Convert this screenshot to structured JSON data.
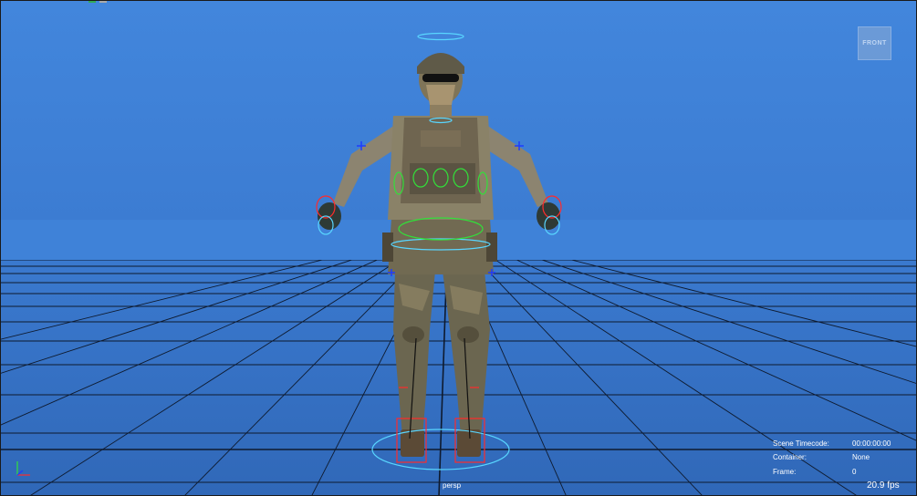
{
  "viewport": {
    "view_cube_label": "FRONT",
    "camera_name": "persp",
    "fps": "20.9 fps"
  },
  "hud": {
    "scene_timecode_label": "Scene Timecode:",
    "scene_timecode_value": "00:00:00:00",
    "container_label": "Container:",
    "container_value": "None",
    "frame_label": "Frame:",
    "frame_value": "0"
  },
  "colors": {
    "viewport_top": "#4286dc",
    "viewport_bottom": "#3068b8",
    "grid": "#0e1a2e",
    "control_cyan": "#59d6ff",
    "control_green": "#32e03a",
    "control_red": "#ff2b2b",
    "control_blue": "#1e3cff"
  },
  "icons": {
    "axis_indicator": "axis-indicator-icon",
    "character": "soldier-character-model"
  }
}
